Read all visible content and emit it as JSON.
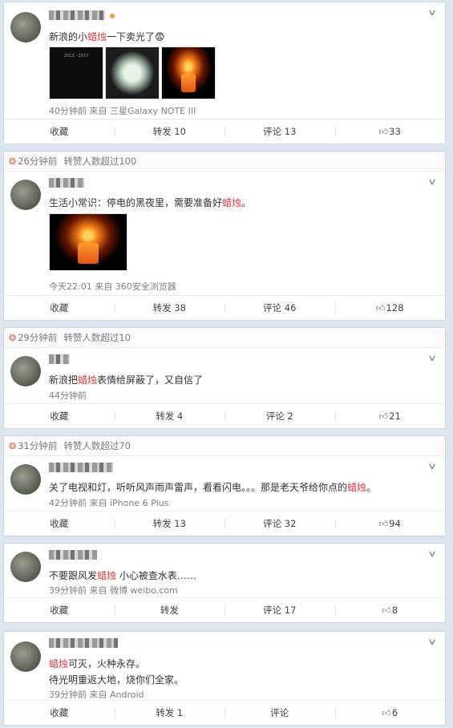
{
  "posts": [
    {
      "text_before": "新浪的小",
      "keyword": "蜡烛",
      "text_after": "一下卖光了😨",
      "image_caption": "2013 - 2017",
      "meta": "40分钟前 来自 三星Galaxy NOTE III",
      "actions": {
        "fav": "收藏",
        "repost": "转发 10",
        "comment": "评论 13",
        "like": "33"
      }
    },
    {
      "head_time": "26分钟前",
      "head_label": "转赞人数超过100",
      "text_before": "生活小常识：停电的黑夜里，需要准备好",
      "keyword": "蜡烛",
      "text_after": "。",
      "meta": "今天22:01 来自 360安全浏览器",
      "actions": {
        "fav": "收藏",
        "repost": "转发 38",
        "comment": "评论 46",
        "like": "128"
      }
    },
    {
      "head_time": "29分钟前",
      "head_label": "转赞人数超过10",
      "text_before": "新浪把",
      "keyword": "蜡烛",
      "text_after": "表情给屏蔽了，又自信了",
      "meta": "44分钟前",
      "actions": {
        "fav": "收藏",
        "repost": "转发 4",
        "comment": "评论 2",
        "like": "21"
      }
    },
    {
      "head_time": "31分钟前",
      "head_label": "转赞人数超过70",
      "text_before": "关了电视和灯，听听风声雨声雷声，看看闪电。。。那是老天爷给你点的",
      "keyword": "蜡烛",
      "text_after": "。",
      "meta": "42分钟前 来自 iPhone 6 Plus",
      "actions": {
        "fav": "收藏",
        "repost": "转发 13",
        "comment": "评论 32",
        "like": "94"
      }
    },
    {
      "text_before": "不要跟风发",
      "keyword": "蜡烛",
      "text_after": " 小心被查水表……",
      "meta": "39分钟前 来自 微博 weibo.com",
      "actions": {
        "fav": "收藏",
        "repost": "转发",
        "comment": "评论 17",
        "like": "8"
      }
    },
    {
      "keyword": "蜡烛",
      "text_after": "可灭，火种永存。",
      "line2": "待光明重返大地，烧你们全家。",
      "meta": "39分钟前 来自 Android",
      "actions": {
        "fav": "收藏",
        "repost": "转发 1",
        "comment": "评论",
        "like": "6"
      }
    }
  ],
  "icons": {
    "chevron": "chevron-down-icon",
    "spark": "hot-icon",
    "like": "thumbs-up-icon"
  },
  "colors": {
    "keyword": "#e4393c",
    "meta": "#808080",
    "background": "#dde6ef"
  }
}
